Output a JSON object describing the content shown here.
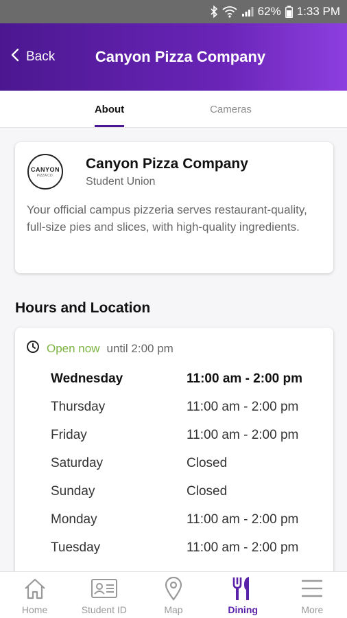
{
  "status_bar": {
    "battery": "62%",
    "time": "1:33 PM"
  },
  "header": {
    "back_label": "Back",
    "title": "Canyon Pizza Company"
  },
  "tabs": [
    {
      "label": "About",
      "active": true
    },
    {
      "label": "Cameras",
      "active": false
    }
  ],
  "about": {
    "logo_text": "CANYON",
    "logo_subtext": "PIZZA CO.",
    "name": "Canyon Pizza Company",
    "location": "Student Union",
    "description": "Your official campus pizzeria serves restaurant-quality, full-size pies and slices, with high-quality ingredients."
  },
  "hours": {
    "section_title": "Hours and Location",
    "open_status": "Open now",
    "open_until": "until 2:00 pm",
    "days": [
      {
        "day": "Wednesday",
        "time": "11:00 am - 2:00 pm",
        "today": true
      },
      {
        "day": "Thursday",
        "time": "11:00 am - 2:00 pm",
        "today": false
      },
      {
        "day": "Friday",
        "time": "11:00 am - 2:00 pm",
        "today": false
      },
      {
        "day": "Saturday",
        "time": "Closed",
        "today": false
      },
      {
        "day": "Sunday",
        "time": "Closed",
        "today": false
      },
      {
        "day": "Monday",
        "time": "11:00 am - 2:00 pm",
        "today": false
      },
      {
        "day": "Tuesday",
        "time": "11:00 am - 2:00 pm",
        "today": false
      }
    ]
  },
  "bottom_nav": [
    {
      "label": "Home",
      "icon": "home-icon",
      "active": false
    },
    {
      "label": "Student ID",
      "icon": "id-card-icon",
      "active": false
    },
    {
      "label": "Map",
      "icon": "map-pin-icon",
      "active": false
    },
    {
      "label": "Dining",
      "icon": "fork-knife-icon",
      "active": true
    },
    {
      "label": "More",
      "icon": "menu-icon",
      "active": false
    }
  ],
  "colors": {
    "header_start": "#4b1790",
    "header_end": "#8d3fdf",
    "accent": "#5a22a8",
    "open_green": "#7cb342"
  }
}
